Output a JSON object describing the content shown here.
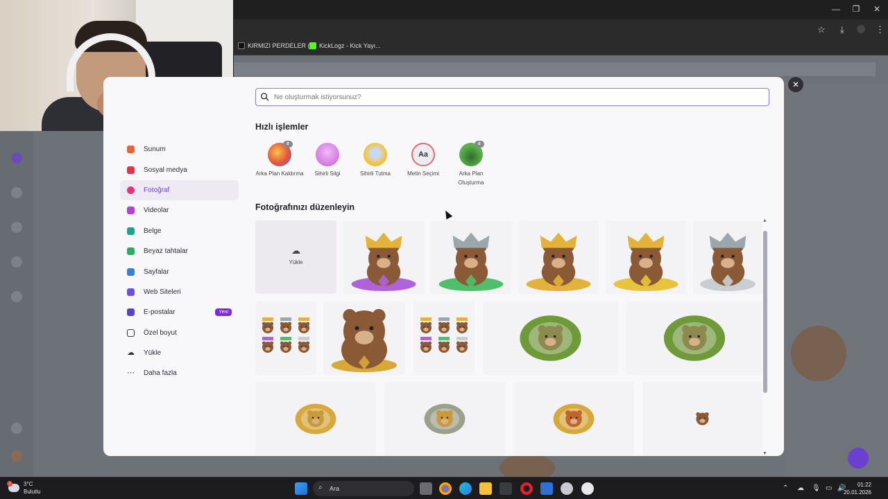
{
  "browser": {
    "bookmarks": [
      {
        "label": "KIRMIZI PERDELER (...",
        "color": "#ffffff"
      },
      {
        "label": "KickLogz - Kick Yayı...",
        "color": "#53fc18"
      }
    ],
    "controls": {
      "minimize": "—",
      "restore": "❐",
      "close": "✕"
    },
    "icons": {
      "star": "☆",
      "download": "⤓",
      "menu": "⋮"
    }
  },
  "modal": {
    "close_label": "✕",
    "search": {
      "placeholder": "Ne oluşturmak istiyorsunuz?",
      "value": ""
    },
    "sidebar": [
      {
        "label": "Sunum",
        "icon": "presentation-icon",
        "color": "#e8643c"
      },
      {
        "label": "Sosyal medya",
        "icon": "heart-icon",
        "color": "#e2334f"
      },
      {
        "label": "Fotoğraf",
        "icon": "camera-icon",
        "color": "#e8317a",
        "active": true
      },
      {
        "label": "Videolar",
        "icon": "video-icon",
        "color": "#b542d8"
      },
      {
        "label": "Belge",
        "icon": "document-icon",
        "color": "#1fa28f"
      },
      {
        "label": "Beyaz tahtalar",
        "icon": "whiteboard-icon",
        "color": "#2bae61"
      },
      {
        "label": "Sayfalar",
        "icon": "pages-icon",
        "color": "#3a7ed8"
      },
      {
        "label": "Web Siteleri",
        "icon": "website-icon",
        "color": "#6f4ee0"
      },
      {
        "label": "E-postalar",
        "icon": "email-icon",
        "color": "#5b3fd1",
        "badge": "Yeni"
      },
      {
        "label": "Özel boyut",
        "icon": "custom-size-icon",
        "color": "#333333"
      },
      {
        "label": "Yükle",
        "icon": "cloud-upload-icon",
        "color": "#333333"
      },
      {
        "label": "Daha fazla",
        "icon": "more-icon",
        "color": "#333333"
      }
    ],
    "quick_actions_title": "Hızlı işlemler",
    "quick_actions": [
      {
        "label": "Arka Plan Kaldırma",
        "icon": "background-remover-icon",
        "color": "#f2a23a",
        "premium": true
      },
      {
        "label": "Sihirli Silgi",
        "icon": "magic-eraser-icon",
        "color": "#d772e6",
        "premium": false
      },
      {
        "label": "Sihirli Tutma",
        "icon": "magic-grab-icon",
        "color": "#f4c33c",
        "premium": false
      },
      {
        "label": "Metin Seçimi",
        "icon": "text-grab-icon",
        "color": "#e46b6b",
        "premium": false
      },
      {
        "label": "Arka Plan Oluşturma",
        "icon": "background-generator-icon",
        "color": "#5bb04b",
        "premium": true
      }
    ],
    "photos_title": "Fotoğrafınızı düzenleyin",
    "upload_tile_label": "Yükle",
    "scroll_position": 0.03
  },
  "taskbar": {
    "weather": {
      "temp": "3°C",
      "condition": "Bulutlu",
      "alert": "1"
    },
    "search_label": "Ara",
    "clock": {
      "time": "01:22",
      "date": "20.01.2026"
    }
  }
}
